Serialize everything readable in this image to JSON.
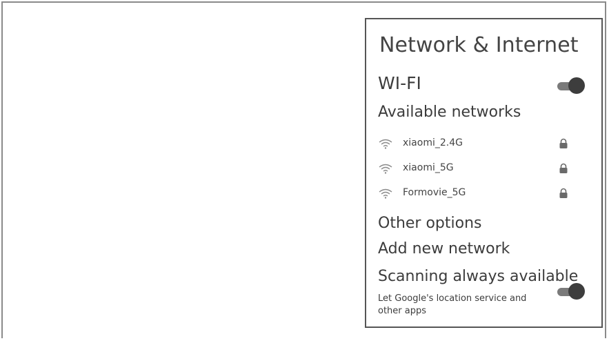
{
  "panel": {
    "title": "Network & Internet",
    "wifi": {
      "label": "WI-FI",
      "enabled": true
    },
    "available_label": "Available networks",
    "networks": [
      {
        "name": "xiaomi_2.4G",
        "icon": "wifi-icon",
        "secured": true
      },
      {
        "name": "xiaomi_5G",
        "icon": "wifi-icon",
        "secured": true
      },
      {
        "name": "Formovie_5G",
        "icon": "wifi-icon",
        "secured": true
      }
    ],
    "other_options_label": "Other options",
    "add_network_label": "Add new network",
    "scanning": {
      "label": "Scanning always available",
      "description": "Let Google's location service and other apps",
      "enabled": true
    }
  },
  "colors": {
    "frame_border": "#8a8a8a",
    "panel_border": "#555555",
    "text": "#3c3c3c",
    "toggle_track": "#7a7a7a",
    "toggle_knob": "#3d3d3d"
  }
}
